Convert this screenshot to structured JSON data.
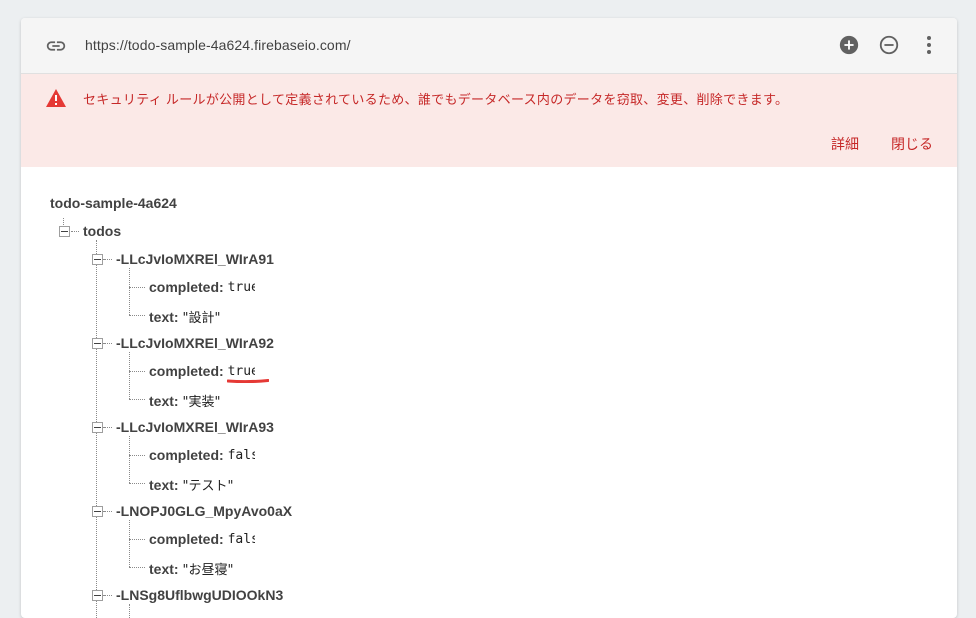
{
  "urlbar": {
    "url": "https://todo-sample-4a624.firebaseio.com/",
    "icons": [
      "link-icon",
      "add-circle-icon",
      "remove-circle-icon",
      "more-vert-icon"
    ]
  },
  "warning": {
    "message": "セキュリティ ルールが公開として定義されているため、誰でもデータベース内のデータを窃取、変更、削除できます。",
    "details_label": "詳細",
    "close_label": "閉じる",
    "color": "#c62828",
    "background": "#fbe9e7"
  },
  "tree": {
    "root": "todo-sample-4a624",
    "collection": "todos",
    "items": [
      {
        "key": "-LLcJvIoMXREl_WIrA91",
        "completed_label": "completed:",
        "completed_value": "true",
        "text_label": "text:",
        "text_value": "設計"
      },
      {
        "key": "-LLcJvIoMXREl_WIrA92",
        "completed_label": "completed:",
        "completed_value": "true",
        "text_label": "text:",
        "text_value": "実装"
      },
      {
        "key": "-LLcJvIoMXREl_WIrA93",
        "completed_label": "completed:",
        "completed_value": "false",
        "text_label": "text:",
        "text_value": "テスト"
      },
      {
        "key": "-LNOPJ0GLG_MpyAvo0aX",
        "completed_label": "completed:",
        "completed_value": "false",
        "text_label": "text:",
        "text_value": "お昼寝"
      },
      {
        "key": "-LNSg8UflbwgUDIOOkN3"
      }
    ]
  },
  "quote_open": "\"",
  "quote_close": "\"",
  "annotation_color": "#e53935"
}
